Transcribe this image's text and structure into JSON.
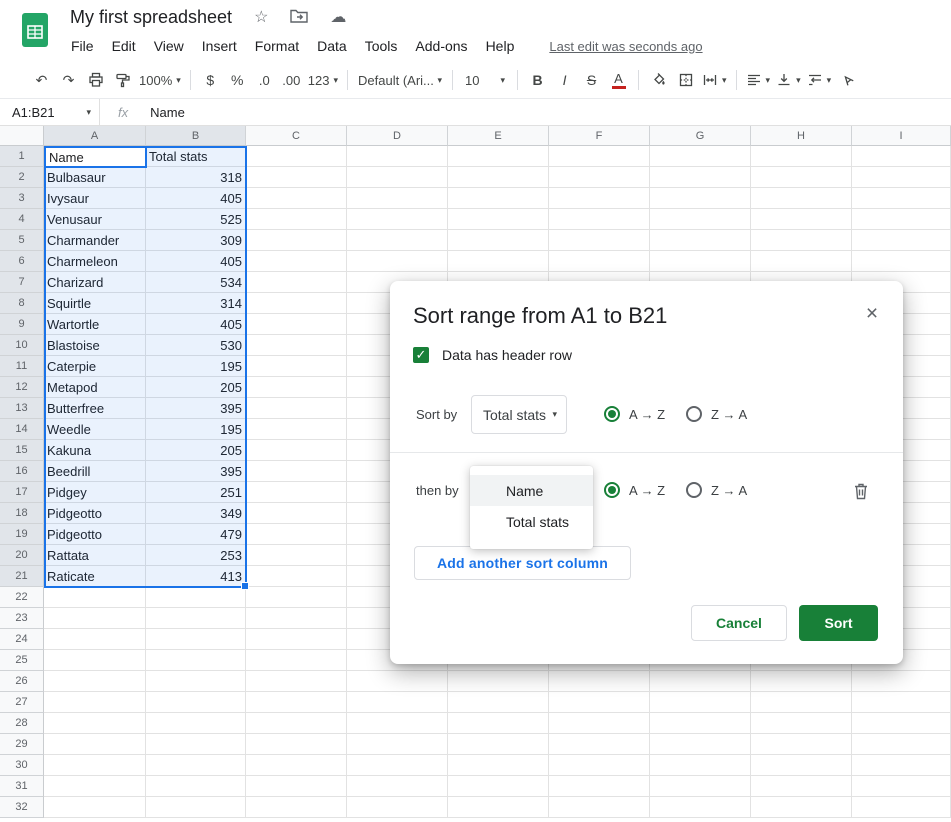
{
  "app": {
    "title": "My first spreadsheet",
    "menu_items": [
      "File",
      "Edit",
      "View",
      "Insert",
      "Format",
      "Data",
      "Tools",
      "Add-ons",
      "Help"
    ],
    "last_edit": "Last edit was seconds ago"
  },
  "icons": {
    "star": "☆",
    "cloud": "☁",
    "undo": "↶",
    "redo": "↷",
    "caret": "▾",
    "close": "×",
    "check": "✓"
  },
  "toolbar": {
    "zoom": "100%",
    "currency": "$",
    "percent": "%",
    "decrease_decimal": ".0",
    "increase_decimal": ".00",
    "number_format": "123",
    "font_name": "Default (Ari...",
    "font_size": "10",
    "bold": "B",
    "italic": "I",
    "strikethrough": "S",
    "text_color": "A"
  },
  "formula": {
    "range": "A1:B21",
    "fx_label": "fx",
    "value": "Name"
  },
  "grid": {
    "columns": [
      "A",
      "B",
      "C",
      "D",
      "E",
      "F",
      "G",
      "H",
      "I"
    ],
    "row_count": 32,
    "selection": {
      "range": "A1:B21",
      "active_cell": "A1",
      "columns": [
        "A",
        "B"
      ],
      "row_end": 21
    },
    "values": [
      [
        "Name",
        "Total stats"
      ],
      [
        "Bulbasaur",
        "318"
      ],
      [
        "Ivysaur",
        "405"
      ],
      [
        "Venusaur",
        "525"
      ],
      [
        "Charmander",
        "309"
      ],
      [
        "Charmeleon",
        "405"
      ],
      [
        "Charizard",
        "534"
      ],
      [
        "Squirtle",
        "314"
      ],
      [
        "Wartortle",
        "405"
      ],
      [
        "Blastoise",
        "530"
      ],
      [
        "Caterpie",
        "195"
      ],
      [
        "Metapod",
        "205"
      ],
      [
        "Butterfree",
        "395"
      ],
      [
        "Weedle",
        "195"
      ],
      [
        "Kakuna",
        "205"
      ],
      [
        "Beedrill",
        "395"
      ],
      [
        "Pidgey",
        "251"
      ],
      [
        "Pidgeotto",
        "349"
      ],
      [
        "Pidgeotto",
        "479"
      ],
      [
        "Rattata",
        "253"
      ],
      [
        "Raticate",
        "413"
      ]
    ]
  },
  "dialog": {
    "title": "Sort range from A1 to B21",
    "header_checkbox": {
      "checked": true,
      "label": "Data has header row"
    },
    "sort_by": {
      "label": "Sort by",
      "value": "Total stats",
      "asc_label": "A → Z",
      "desc_label": "Z → A",
      "selected": "asc"
    },
    "then_by": {
      "label": "then by",
      "asc_label": "A → Z",
      "desc_label": "Z → A",
      "selected": "asc"
    },
    "column_menu": {
      "items": [
        "Name",
        "Total stats"
      ],
      "highlighted": "Name"
    },
    "add_button_label": "Add another sort column",
    "cancel_label": "Cancel",
    "sort_label": "Sort",
    "colors": {
      "accent_green": "#188038",
      "link_blue": "#1a73e8",
      "selection_blue": "#1a73e8"
    }
  }
}
